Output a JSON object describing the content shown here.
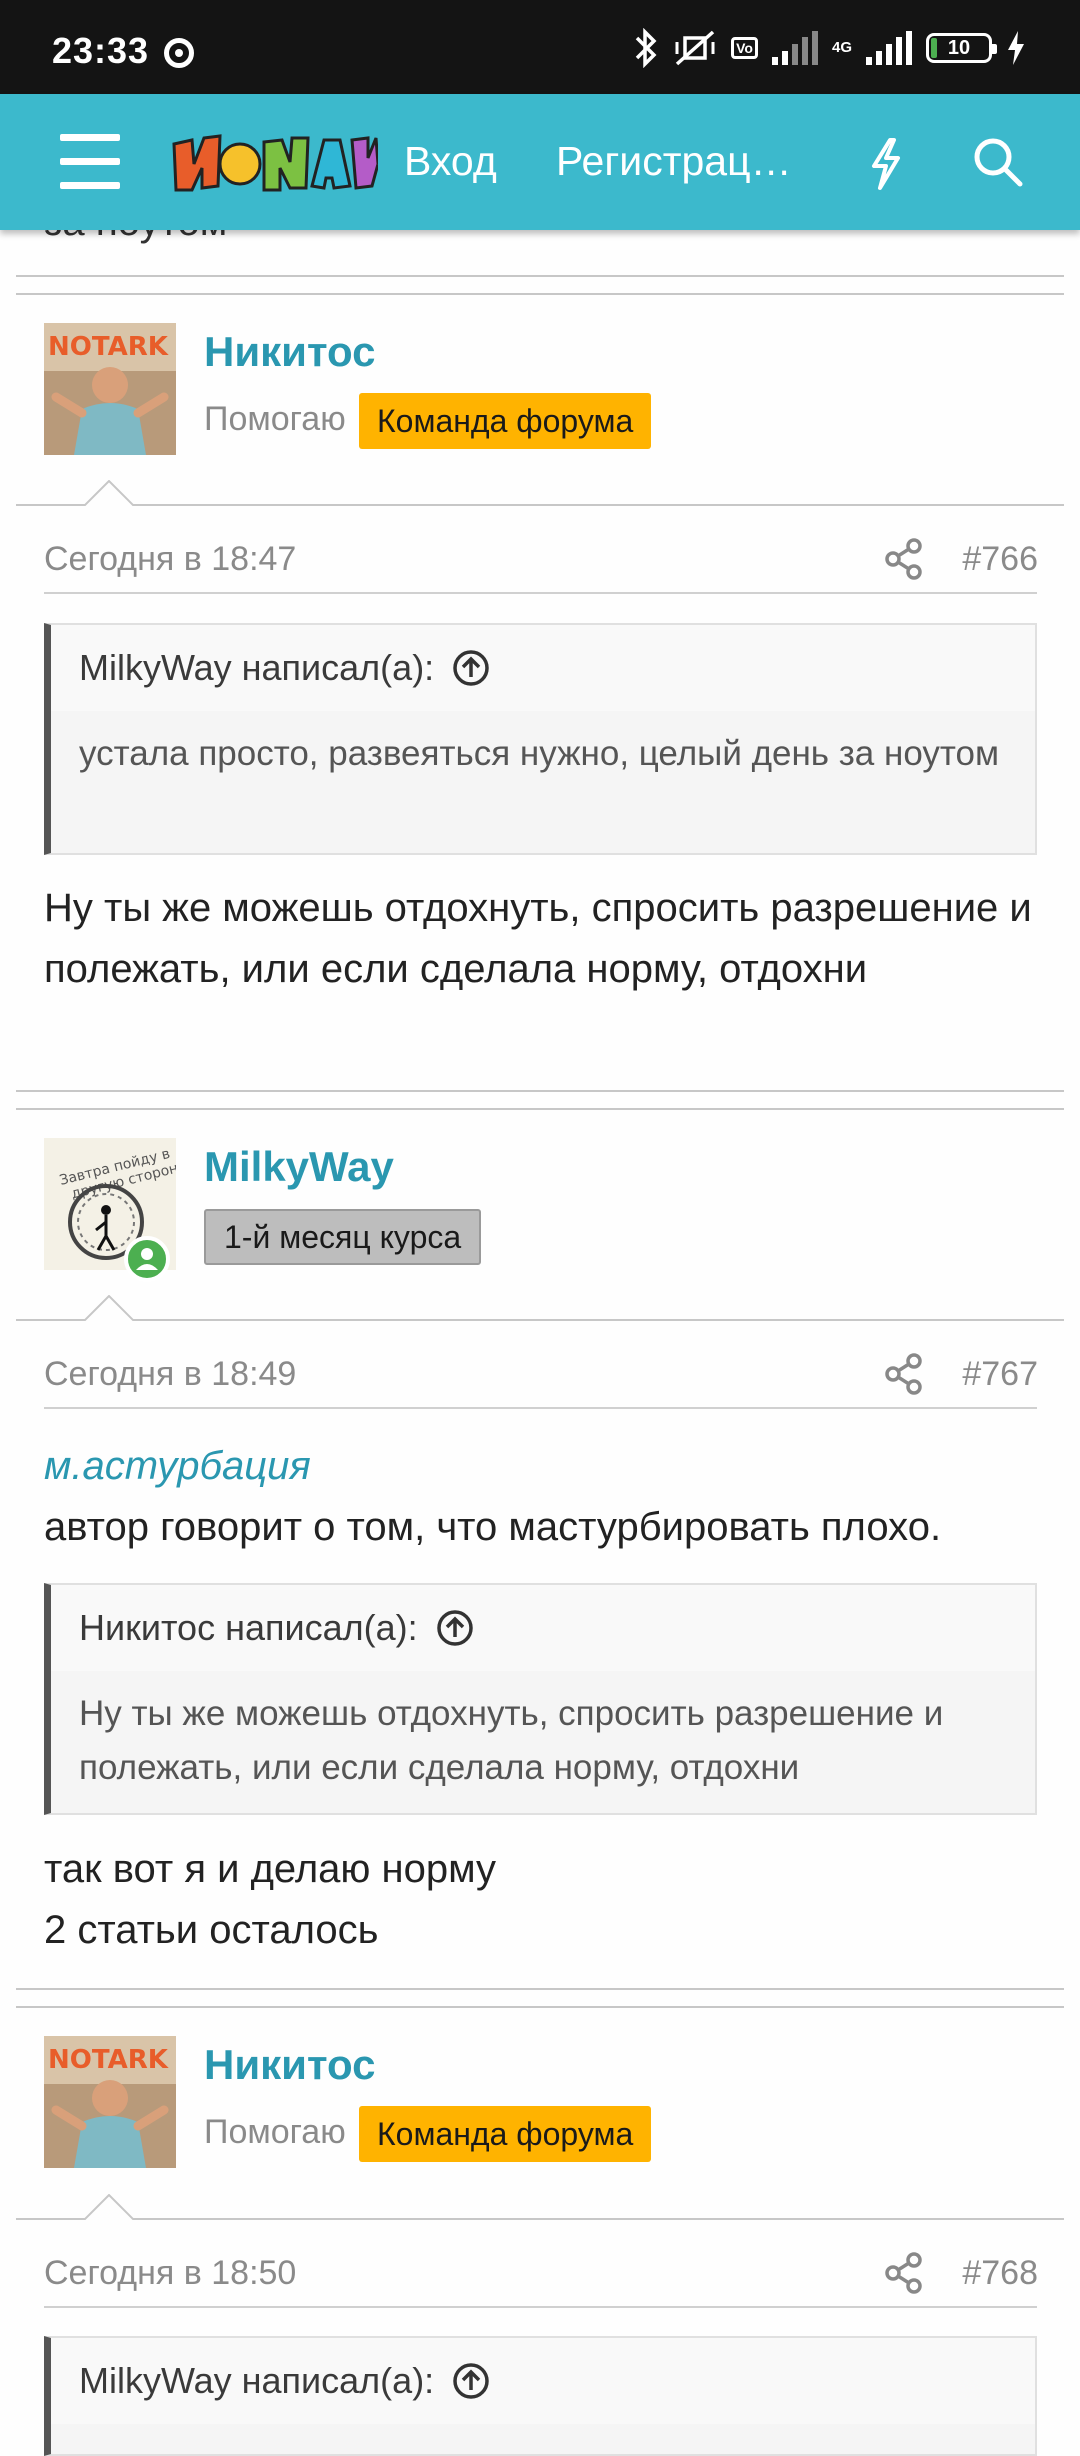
{
  "status_bar": {
    "time": "23:33",
    "battery": "10",
    "network": "4G"
  },
  "header": {
    "login": "Вход",
    "register": "Регистрац…"
  },
  "cut_text": "за ноутом",
  "posts": [
    {
      "username": "Никитос",
      "user_title": "Помогаю",
      "badge": "Команда форума",
      "date": "Сегодня в 18:47",
      "number": "#766",
      "quote_author": "MilkyWay написал(а):",
      "quote_text": "устала просто, развеяться нужно, целый день за ноутом",
      "body": "Ну ты же можешь отдохнуть, спросить разрешение и полежать, или если сделала норму, отдохни"
    },
    {
      "username": "MilkyWay",
      "badge": "1-й месяц курса",
      "date": "Сегодня в 18:49",
      "number": "#767",
      "tag_link": "м.астурбация",
      "intro": "автор говорит о том, что мастурбировать плохо.",
      "quote_author": "Никитос написал(а):",
      "quote_text": "Ну ты же можешь отдохнуть, спросить разрешение и полежать, или если сделала норму, отдохни",
      "body_line1": "так вот я и делаю норму",
      "body_line2": "2 статьи осталось"
    },
    {
      "username": "Никитос",
      "user_title": "Помогаю",
      "badge": "Команда форума",
      "date": "Сегодня в 18:50",
      "number": "#768",
      "quote_author": "MilkyWay написал(а):"
    }
  ],
  "colors": {
    "header": "#3cb9cc",
    "username": "#2a97b0",
    "team_badge": "#ffb300",
    "online": "#4caf50"
  }
}
